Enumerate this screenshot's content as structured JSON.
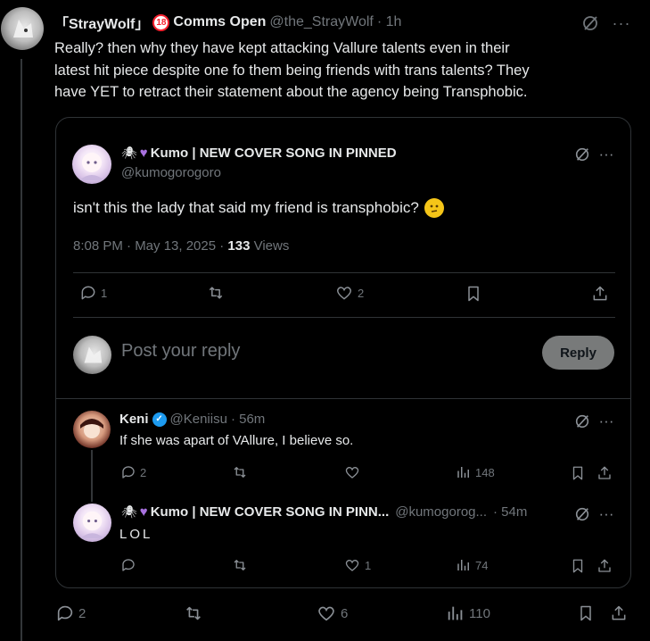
{
  "main_post": {
    "display_name": "「StrayWolf」",
    "badge_emoji": "🔞",
    "name_suffix": "Comms Open",
    "handle": "@the_StrayWolf",
    "time": "· 1h",
    "text_line1": "Really? then why they have kept attacking Vallure talents even in their",
    "text_line2": "latest hit piece despite one fo them being friends with trans talents? They",
    "text_line3": "have YET to retract their statement about the agency being Transphobic.",
    "actions": {
      "replies": "2",
      "reposts": "",
      "likes": "6",
      "views": "110"
    }
  },
  "quoted_post": {
    "display_name": "Kumo | NEW COVER SONG IN PINNED",
    "handle": "@kumogorogoro",
    "text": "isn't this the lady that said my friend is transphobic?",
    "timestamp": "8:08 PM · May 13, 2025 · ",
    "views_count": "133",
    "views_label": " Views",
    "actions": {
      "replies": "1",
      "reposts": "",
      "likes": "2"
    }
  },
  "reply_box": {
    "placeholder": "Post your reply",
    "button_label": "Reply"
  },
  "replies": [
    {
      "display_name": "Keni",
      "handle": "@Keniisu",
      "time": "· 56m",
      "text": "If she was apart of VAllure, I believe so.",
      "actions": {
        "replies": "2",
        "reposts": "",
        "likes": "",
        "views": "148"
      }
    },
    {
      "display_name": "Kumo | NEW COVER SONG IN PINN...",
      "handle": "@kumogorog...",
      "time": "· 54m",
      "text": "LOL",
      "actions": {
        "replies": "",
        "reposts": "",
        "likes": "1",
        "views": "74"
      }
    }
  ]
}
